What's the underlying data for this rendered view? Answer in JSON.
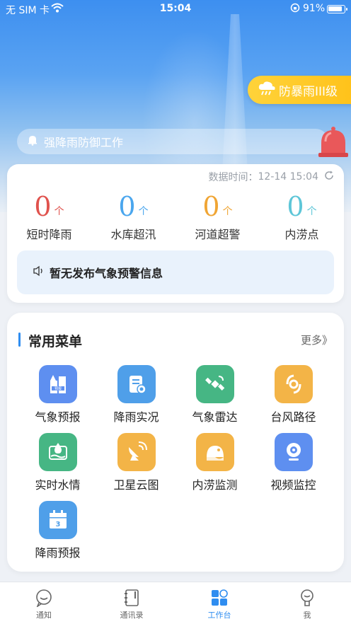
{
  "status_bar": {
    "carrier": "无 SIM 卡",
    "time": "15:04",
    "battery": "91%"
  },
  "warning_badge": {
    "label": "防暴雨III级",
    "color": "#ffc21a"
  },
  "notice": {
    "text": "强降雨防御工作"
  },
  "overview": {
    "data_time_label": "数据时间：",
    "data_time": "12-14 15:04",
    "stats": [
      {
        "value": "0",
        "unit": "个",
        "label": "短时降雨",
        "color": "#e0524d"
      },
      {
        "value": "0",
        "unit": "个",
        "label": "水库超汛",
        "color": "#4aa6ee"
      },
      {
        "value": "0",
        "unit": "个",
        "label": "河道超警",
        "color": "#f0a534"
      },
      {
        "value": "0",
        "unit": "个",
        "label": "内涝点",
        "color": "#5ec6d8"
      }
    ],
    "warning_text": "暂无发布气象预警信息"
  },
  "menu": {
    "title": "常用菜单",
    "more": "更多》",
    "items": [
      {
        "label": "气象预报",
        "icon": "weather-forecast-icon",
        "color": "#5e8ff0"
      },
      {
        "label": "降雨实况",
        "icon": "rainfall-live-icon",
        "color": "#4f9fe9"
      },
      {
        "label": "气象雷达",
        "icon": "satellite-radar-icon",
        "color": "#46b684"
      },
      {
        "label": "台风路径",
        "icon": "typhoon-icon",
        "color": "#f3b447"
      },
      {
        "label": "实时水情",
        "icon": "water-level-icon",
        "color": "#46b684"
      },
      {
        "label": "卫星云图",
        "icon": "satellite-dish-icon",
        "color": "#f3b447"
      },
      {
        "label": "内涝监测",
        "icon": "waterlogging-icon",
        "color": "#f3b447"
      },
      {
        "label": "视频监控",
        "icon": "camera-icon",
        "color": "#5e8ff0"
      },
      {
        "label": "降雨预报",
        "icon": "calendar-icon",
        "color": "#4f9fe9"
      }
    ]
  },
  "tabs": [
    {
      "label": "通知",
      "icon": "chat-icon"
    },
    {
      "label": "通讯录",
      "icon": "contacts-icon"
    },
    {
      "label": "工作台",
      "icon": "workbench-icon",
      "active": true
    },
    {
      "label": "我",
      "icon": "profile-icon"
    }
  ]
}
